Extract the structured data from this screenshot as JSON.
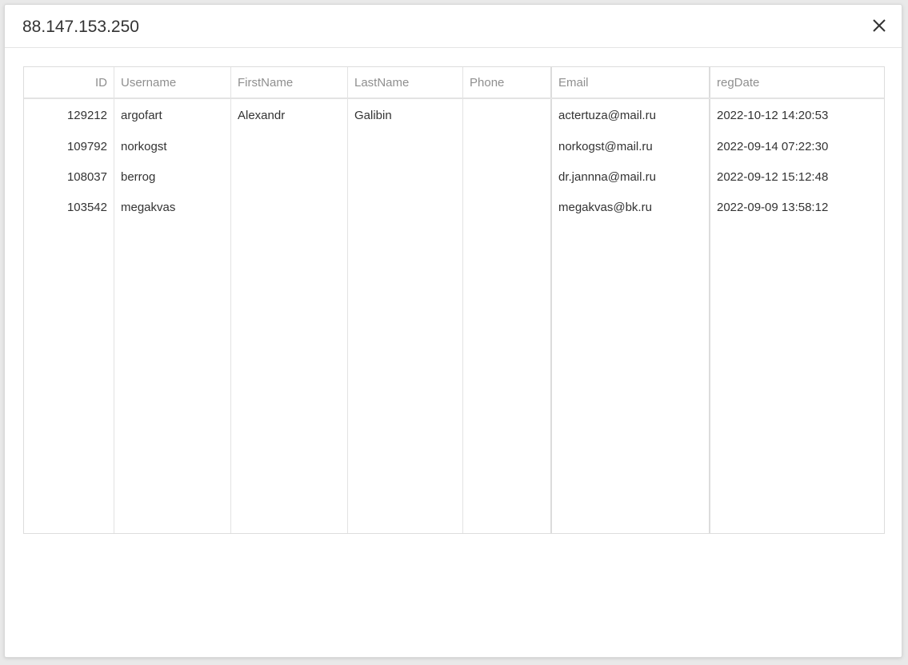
{
  "dialog": {
    "title": "88.147.153.250",
    "close_icon": "close-icon"
  },
  "table": {
    "columns": [
      "ID",
      "Username",
      "FirstName",
      "LastName",
      "Phone",
      "Email",
      "regDate"
    ],
    "rows": [
      {
        "id": "129212",
        "username": "argofart",
        "firstname": "Alexandr",
        "lastname": "Galibin",
        "phone": "",
        "email": "actertuza@mail.ru",
        "regdate": "2022-10-12 14:20:53"
      },
      {
        "id": "109792",
        "username": "norkogst",
        "firstname": "",
        "lastname": "",
        "phone": "",
        "email": "norkogst@mail.ru",
        "regdate": "2022-09-14 07:22:30"
      },
      {
        "id": "108037",
        "username": "berrog",
        "firstname": "",
        "lastname": "",
        "phone": "",
        "email": "dr.jannna@mail.ru",
        "regdate": "2022-09-12 15:12:48"
      },
      {
        "id": "103542",
        "username": "megakvas",
        "firstname": "",
        "lastname": "",
        "phone": "",
        "email": "megakvas@bk.ru",
        "regdate": "2022-09-09 13:58:12"
      }
    ]
  }
}
